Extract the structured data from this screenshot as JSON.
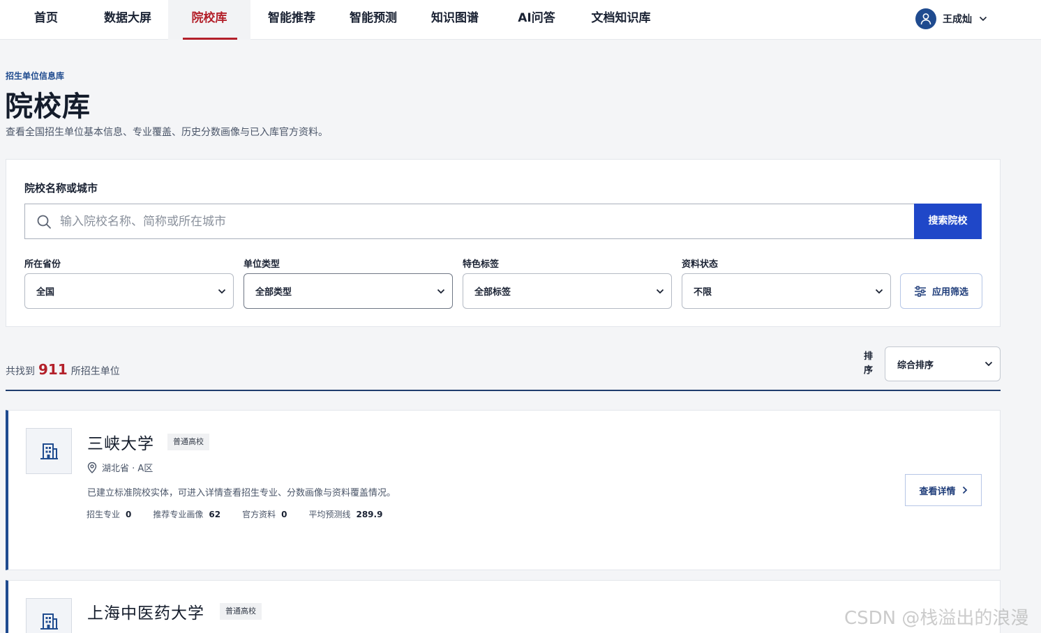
{
  "nav": {
    "items": [
      "首页",
      "数据大屏",
      "院校库",
      "智能推荐",
      "智能预测",
      "知识图谱",
      "AI问答",
      "文档知识库"
    ],
    "active": "院校库",
    "user_name": "王成灿"
  },
  "header": {
    "eyebrow": "招生单位信息库",
    "title": "院校库",
    "description": "查看全国招生单位基本信息、专业覆盖、历史分数画像与已入库官方资料。"
  },
  "search": {
    "label": "院校名称或城市",
    "placeholder": "输入院校名称、简称或所在城市",
    "value": "",
    "button": "搜索院校"
  },
  "filters": [
    {
      "label": "所在省份",
      "value": "全国"
    },
    {
      "label": "单位类型",
      "value": "全部类型"
    },
    {
      "label": "特色标签",
      "value": "全部标签"
    },
    {
      "label": "资料状态",
      "value": "不限"
    }
  ],
  "apply_button": "应用筛选",
  "results": {
    "prefix": "共找到",
    "count": "911",
    "suffix": "所招生单位",
    "sort_label": "排序",
    "sort_value": "综合排序"
  },
  "cards": [
    {
      "name": "三峡大学",
      "tag": "普通高校",
      "location": "湖北省 · A区",
      "description": "已建立标准院校实体，可进入详情查看招生专业、分数画像与资料覆盖情况。",
      "stats": [
        {
          "label": "招生专业",
          "value": "0"
        },
        {
          "label": "推荐专业画像",
          "value": "62"
        },
        {
          "label": "官方资料",
          "value": "0"
        },
        {
          "label": "平均预测线",
          "value": "289.9"
        }
      ],
      "detail_button": "查看详情"
    },
    {
      "name": "上海中医药大学",
      "tag": "普通高校"
    }
  ],
  "watermark": "CSDN @栈溢出的浪漫",
  "colors": {
    "accent_red": "#b3202a",
    "primary_blue": "#1f47c8",
    "navy": "#1f4b8f"
  },
  "icons": [
    "user-icon",
    "chevron-down-icon",
    "search-icon",
    "filter-sliders-icon",
    "building-icon",
    "location-pin-icon",
    "chevron-right-icon"
  ]
}
